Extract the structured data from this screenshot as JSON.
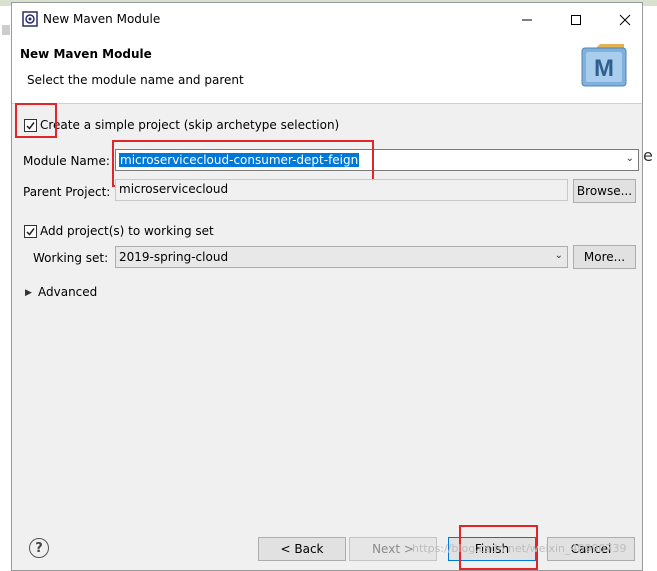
{
  "window": {
    "title": "New Maven Module",
    "minimize_icon": "minimize-icon",
    "maximize_icon": "maximize-icon",
    "close_icon": "close-icon"
  },
  "header": {
    "title": "New Maven Module",
    "description": "Select the module name and parent",
    "logo_text": "M"
  },
  "form": {
    "simple_project": {
      "label": "Create a simple project (skip archetype selection)",
      "checked": true
    },
    "module_name": {
      "label": "Module Name:",
      "value": "microservicecloud-consumer-dept-feign"
    },
    "parent_project": {
      "label": "Parent Project:",
      "value": "microservicecloud",
      "browse_label": "Browse..."
    },
    "working_set_checkbox": {
      "label": "Add project(s) to working set",
      "checked": true
    },
    "working_set": {
      "label": "Working set:",
      "value": "2019-spring-cloud",
      "more_label": "More..."
    },
    "advanced": {
      "label": "Advanced"
    }
  },
  "footer": {
    "help_label": "?",
    "back_label": "< Back",
    "next_label": "Next >",
    "finish_label": "Finish",
    "cancel_label": "Cancel",
    "watermark": "https://blog.csdn.net/weixin_40990739"
  },
  "edge_fragment": "e",
  "colors": {
    "highlight_box": "#e0262a",
    "selection": "#0078d7"
  }
}
